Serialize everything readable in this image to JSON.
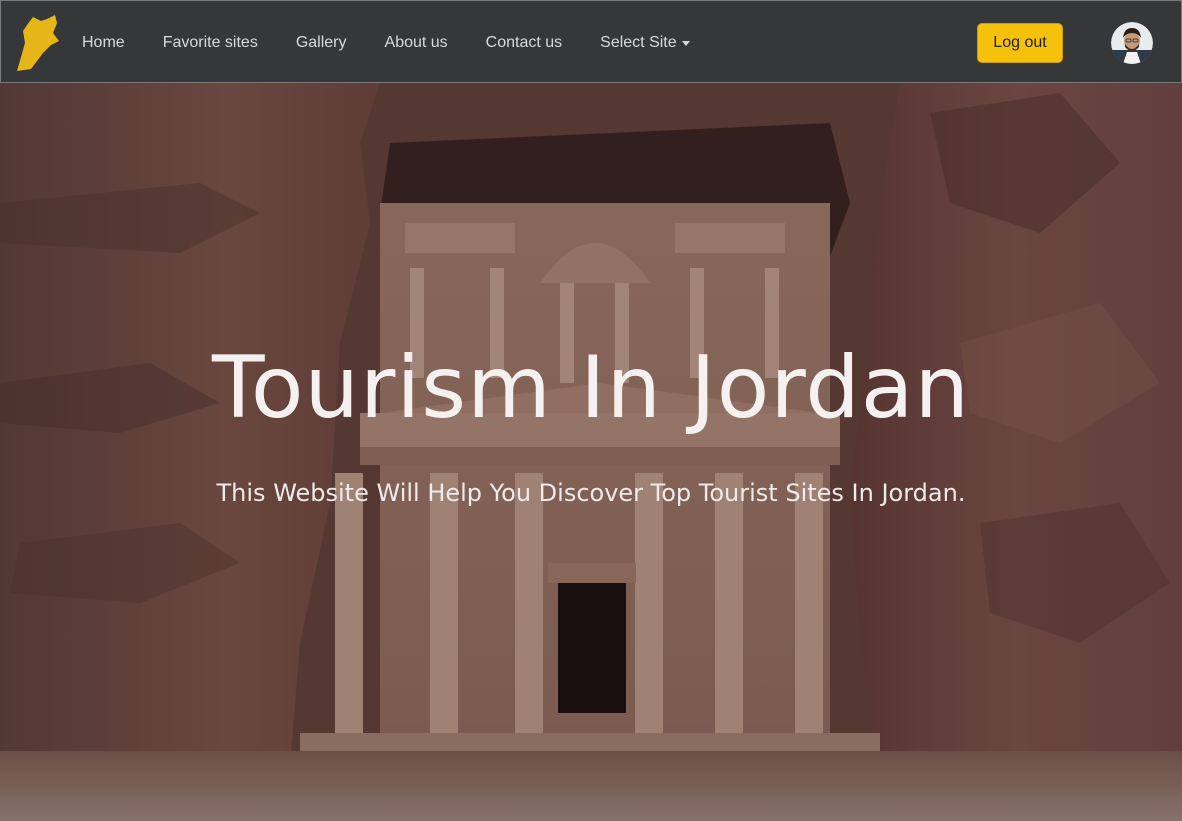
{
  "navbar": {
    "logo_icon": "jordan-map-icon",
    "links": [
      {
        "label": "Home"
      },
      {
        "label": "Favorite sites"
      },
      {
        "label": "Gallery"
      },
      {
        "label": "About us"
      },
      {
        "label": "Contact us"
      },
      {
        "label": "Select Site"
      }
    ],
    "logout_label": "Log out",
    "avatar_icon": "user-avatar-icon"
  },
  "hero": {
    "title": "Tourism In Jordan",
    "subtitle": "This Website Will Help You Discover Top Tourist Sites In Jordan."
  },
  "colors": {
    "navbar_bg": "#363738",
    "logout_bg": "#f6c10a",
    "logo_color": "#e6b619"
  }
}
